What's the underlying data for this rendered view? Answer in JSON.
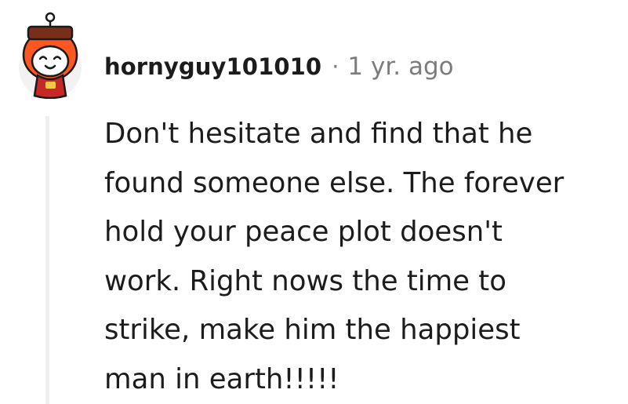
{
  "comment": {
    "author": "hornyguy101010",
    "separator": "·",
    "timestamp": "1 yr. ago",
    "body": "Don't hesitate and find that he\nfound someone else. The forever\nhold your peace plot doesn't\nwork. Right nows the time to\nstrike, make him the happiest\nman in earth!!!!!",
    "avatar": {
      "icon": "snoo-avatar-icon",
      "colors": {
        "hood": "#ff5722",
        "face": "#ffffff",
        "shirt": "#c62828",
        "badge": "#f6c544",
        "background": "#f2f2f2"
      }
    }
  },
  "colors": {
    "username": "#1c1c1c",
    "meta_gray": "#7c7c7c",
    "thread_line": "#edeff1"
  }
}
